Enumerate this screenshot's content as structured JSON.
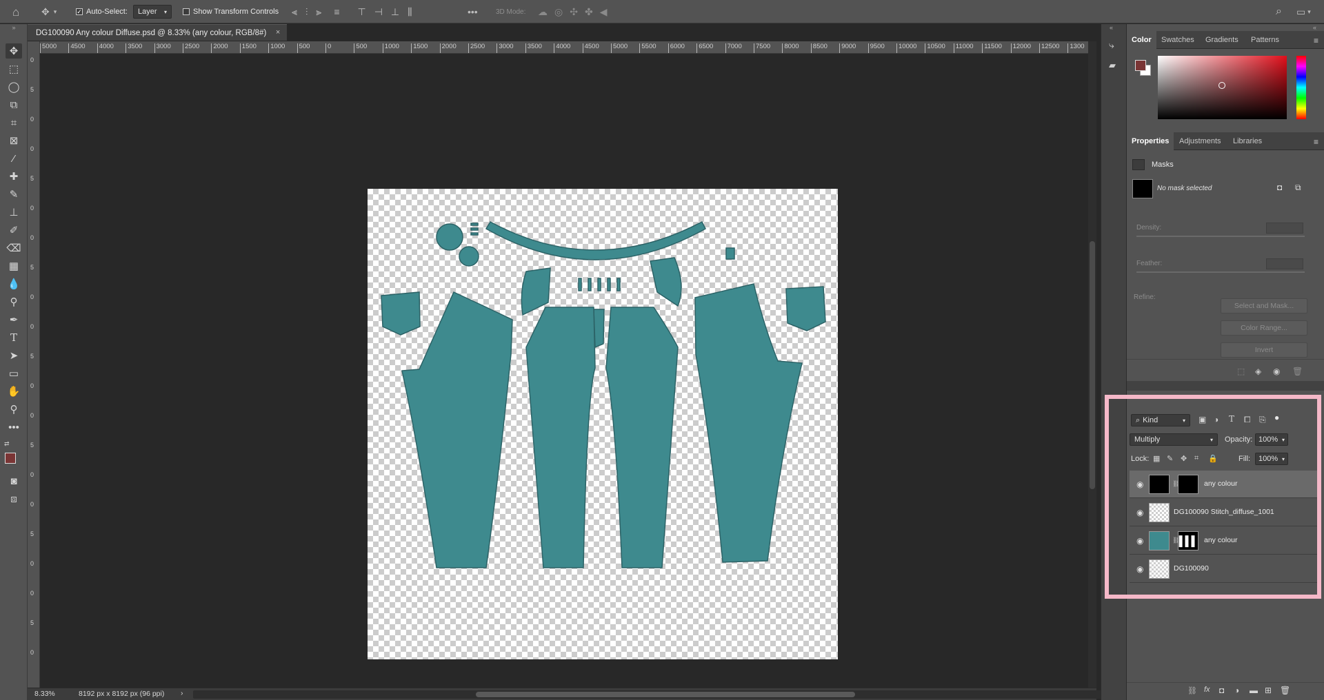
{
  "options_bar": {
    "auto_select_label": "Auto-Select:",
    "auto_select_target": "Layer",
    "show_transform_label": "Show Transform Controls",
    "mode_3d_label": "3D Mode:",
    "more_label": "•••"
  },
  "document": {
    "tab_title": "DG100090 Any colour Diffuse.psd @ 8.33% (any colour, RGB/8#)",
    "close_glyph": "×",
    "garment_color": "#3e8a8e"
  },
  "ruler": {
    "h_ticks": [
      "5000",
      "4500",
      "4000",
      "3500",
      "3000",
      "2500",
      "2000",
      "1500",
      "1000",
      "500",
      "0",
      "500",
      "1000",
      "1500",
      "2000",
      "2500",
      "3000",
      "3500",
      "4000",
      "4500",
      "5000",
      "5500",
      "6000",
      "6500",
      "7000",
      "7500",
      "8000",
      "8500",
      "9000",
      "9500",
      "10000",
      "10500",
      "11000",
      "11500",
      "12000",
      "12500",
      "1300"
    ],
    "v_ticks": [
      "0",
      "5",
      "0",
      "0",
      "5",
      "0",
      "0",
      "5",
      "0",
      "0",
      "5",
      "0",
      "0",
      "5",
      "0",
      "0",
      "5",
      "0",
      "0",
      "5",
      "0"
    ]
  },
  "status": {
    "zoom": "8.33%",
    "doc_size": "8192 px x 8192 px (96 ppi)"
  },
  "color_panel": {
    "tabs": [
      "Color",
      "Swatches",
      "Gradients",
      "Patterns"
    ],
    "foreground_color": "#7a3535",
    "background_color": "#ffffff"
  },
  "properties_panel": {
    "tabs": [
      "Properties",
      "Adjustments",
      "Libraries"
    ],
    "section_label": "Masks",
    "no_mask_text": "No mask selected",
    "density_label": "Density:",
    "feather_label": "Feather:",
    "refine_label": "Refine:",
    "select_mask_button": "Select and Mask...",
    "color_range_button": "Color Range...",
    "invert_button": "Invert"
  },
  "layers_panel": {
    "filter_kind": "Kind",
    "blend_mode": "Multiply",
    "opacity_label": "Opacity:",
    "opacity_value": "100%",
    "lock_label": "Lock:",
    "fill_label": "Fill:",
    "fill_value": "100%",
    "layers": [
      {
        "name": "any colour",
        "selected": true,
        "thumb": "black",
        "mask": "black"
      },
      {
        "name": "DG100090 Stitch_diffuse_1001",
        "selected": false,
        "thumb": "checker",
        "mask": null
      },
      {
        "name": "any colour",
        "selected": false,
        "thumb": "teal",
        "mask": "silhouette"
      },
      {
        "name": "DG100090",
        "selected": false,
        "thumb": "checker",
        "mask": null
      }
    ]
  },
  "highlight_color": "#f5b8c8"
}
